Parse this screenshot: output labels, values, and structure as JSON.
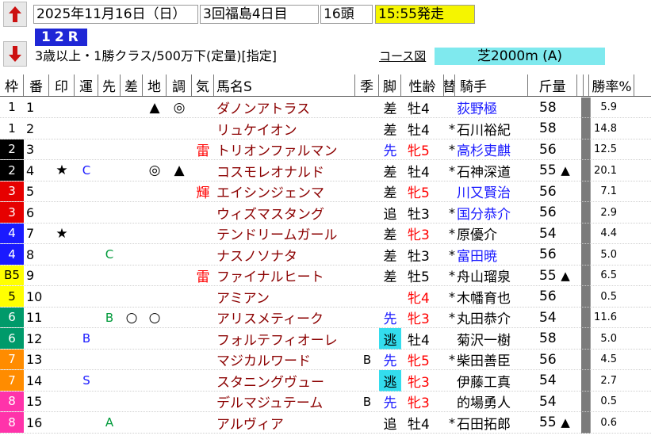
{
  "header": {
    "date": "2025年11月16日（日）",
    "meeting": "3回福島4日目",
    "runners": "16頭",
    "post_time": "15:55発走",
    "race_no": "12R",
    "conditions": "3歳以上・1勝クラス/500万下(定量)[指定]",
    "course_label": "コース図",
    "course": "芝2000m (A)"
  },
  "icons": {
    "up": "up-arrow-icon",
    "down": "down-arrow-icon"
  },
  "colors": {
    "up_arrow": "#cc1111",
    "down_arrow": "#cc1111",
    "race_no_bg": "#1f27d6",
    "post_time_bg": "#f5f500",
    "course_bg": "#7fe9ee"
  },
  "columns": [
    "枠",
    "番",
    "印",
    "運",
    "先",
    "差",
    "地",
    "調",
    "気",
    "馬名S",
    "季",
    "脚",
    "性齢",
    "替",
    "騎手",
    "斤量",
    "勝率%"
  ],
  "rows": [
    {
      "gate": "1",
      "gate_bg": "#ffffff",
      "gate_fg": "#000000",
      "no": "1",
      "mark1": "",
      "mark2": "",
      "sen": "",
      "sa": "",
      "chi": "▲",
      "cho": "◎",
      "ki": "",
      "name": "ダノンアトラス",
      "season": "",
      "style": "差",
      "style_bg": "",
      "sex": "牡4",
      "sex_color": "#000000",
      "change": "",
      "jockey": "荻野極",
      "jockey_color": "#1a1aff",
      "weight": "58",
      "wmark": "",
      "rate": "5.9"
    },
    {
      "gate": "1",
      "gate_bg": "#ffffff",
      "gate_fg": "#000000",
      "no": "2",
      "mark1": "",
      "mark2": "",
      "sen": "",
      "sa": "",
      "chi": "",
      "cho": "",
      "ki": "",
      "name": "リュケイオン",
      "season": "",
      "style": "差",
      "style_bg": "",
      "sex": "牡4",
      "sex_color": "#000000",
      "change": "*",
      "jockey": "石川裕紀",
      "jockey_color": "#000000",
      "weight": "58",
      "wmark": "",
      "rate": "14.8"
    },
    {
      "gate": "2",
      "gate_bg": "#000000",
      "gate_fg": "#ffffff",
      "no": "3",
      "mark1": "",
      "mark2": "",
      "sen": "",
      "sa": "",
      "chi": "",
      "cho": "",
      "ki": "雷",
      "name": "トリオンファルマン",
      "season": "",
      "style": "先",
      "style_bg": "",
      "style_color": "#1a1aff",
      "sex": "牝5",
      "sex_color": "#ff0000",
      "change": "*",
      "jockey": "高杉吏麒",
      "jockey_color": "#1a1aff",
      "weight": "56",
      "wmark": "",
      "rate": "12.5"
    },
    {
      "gate": "2",
      "gate_bg": "#000000",
      "gate_fg": "#ffffff",
      "no": "4",
      "mark1": "★",
      "mark2": "C",
      "sen": "",
      "sa": "",
      "chi": "◎",
      "cho": "▲",
      "ki": "",
      "name": "コスモレオナルド",
      "season": "",
      "style": "差",
      "style_bg": "",
      "sex": "牡4",
      "sex_color": "#000000",
      "change": "*",
      "jockey": "石神深道",
      "jockey_color": "#000000",
      "weight": "55",
      "wmark": "▲",
      "rate": "20.1"
    },
    {
      "gate": "3",
      "gate_bg": "#e60000",
      "gate_fg": "#ffffff",
      "no": "5",
      "mark1": "",
      "mark2": "",
      "sen": "",
      "sa": "",
      "chi": "",
      "cho": "",
      "ki": "輝",
      "name": "エイシンジェンマ",
      "season": "",
      "style": "差",
      "style_bg": "",
      "sex": "牝5",
      "sex_color": "#ff0000",
      "change": "",
      "jockey": "川又賢治",
      "jockey_color": "#1a1aff",
      "weight": "56",
      "wmark": "",
      "rate": "7.1"
    },
    {
      "gate": "3",
      "gate_bg": "#e60000",
      "gate_fg": "#ffffff",
      "no": "6",
      "mark1": "",
      "mark2": "",
      "sen": "",
      "sa": "",
      "chi": "",
      "cho": "",
      "ki": "",
      "name": "ウィズマスタング",
      "season": "",
      "style": "追",
      "style_bg": "",
      "sex": "牡3",
      "sex_color": "#000000",
      "change": "*",
      "jockey": "国分恭介",
      "jockey_color": "#1a1aff",
      "weight": "56",
      "wmark": "",
      "rate": "2.9"
    },
    {
      "gate": "4",
      "gate_bg": "#1a1aff",
      "gate_fg": "#ffffff",
      "no": "7",
      "mark1": "★",
      "mark2": "",
      "sen": "",
      "sa": "",
      "chi": "",
      "cho": "",
      "ki": "",
      "name": "テンドリームガール",
      "season": "",
      "style": "差",
      "style_bg": "",
      "sex": "牝3",
      "sex_color": "#ff0000",
      "change": "*",
      "jockey": "原優介",
      "jockey_color": "#000000",
      "weight": "54",
      "wmark": "",
      "rate": "4.4"
    },
    {
      "gate": "4",
      "gate_bg": "#1a1aff",
      "gate_fg": "#ffffff",
      "no": "8",
      "mark1": "",
      "mark2": "",
      "sen": "C",
      "sa": "",
      "chi": "",
      "cho": "",
      "ki": "",
      "name": "ナスノソナタ",
      "season": "",
      "style": "差",
      "style_bg": "",
      "sex": "牡3",
      "sex_color": "#000000",
      "change": "*",
      "jockey": "富田暁",
      "jockey_color": "#1a1aff",
      "weight": "56",
      "wmark": "",
      "rate": "5.0"
    },
    {
      "gate": "B5",
      "gate_bg": "#ffff00",
      "gate_fg": "#000000",
      "no": "9",
      "mark1": "",
      "mark2": "",
      "sen": "",
      "sa": "",
      "chi": "",
      "cho": "",
      "ki": "雷",
      "name": "ファイナルヒート",
      "season": "",
      "style": "差",
      "style_bg": "",
      "sex": "牡5",
      "sex_color": "#000000",
      "change": "*",
      "jockey": "舟山瑠泉",
      "jockey_color": "#000000",
      "weight": "55",
      "wmark": "▲",
      "rate": "6.5"
    },
    {
      "gate": "5",
      "gate_bg": "#ffff00",
      "gate_fg": "#000000",
      "no": "10",
      "mark1": "",
      "mark2": "",
      "sen": "",
      "sa": "",
      "chi": "",
      "cho": "",
      "ki": "",
      "name": "アミアン",
      "season": "",
      "style": "",
      "style_bg": "",
      "sex": "牝4",
      "sex_color": "#ff0000",
      "change": "*",
      "jockey": "木幡育也",
      "jockey_color": "#000000",
      "weight": "56",
      "wmark": "",
      "rate": "0.5"
    },
    {
      "gate": "6",
      "gate_bg": "#009a6a",
      "gate_fg": "#ffffff",
      "no": "11",
      "mark1": "",
      "mark2": "",
      "sen": "B",
      "sa": "○",
      "chi": "○",
      "cho": "",
      "ki": "",
      "name": "アリスメティーク",
      "season": "",
      "style": "先",
      "style_bg": "",
      "style_color": "#1a1aff",
      "sex": "牝3",
      "sex_color": "#ff0000",
      "change": "*",
      "jockey": "丸田恭介",
      "jockey_color": "#000000",
      "weight": "54",
      "wmark": "",
      "rate": "11.6"
    },
    {
      "gate": "6",
      "gate_bg": "#009a6a",
      "gate_fg": "#ffffff",
      "no": "12",
      "mark1": "",
      "mark2": "B",
      "sen": "",
      "sa": "",
      "chi": "",
      "cho": "",
      "ki": "",
      "name": "フォルテフィオーレ",
      "season": "",
      "style": "逃",
      "style_bg": "#33ddee",
      "sex": "牡4",
      "sex_color": "#000000",
      "change": "",
      "jockey": "菊沢一樹",
      "jockey_color": "#000000",
      "weight": "58",
      "wmark": "",
      "rate": "5.0"
    },
    {
      "gate": "7",
      "gate_bg": "#ff8c00",
      "gate_fg": "#ffffff",
      "no": "13",
      "mark1": "",
      "mark2": "",
      "sen": "",
      "sa": "",
      "chi": "",
      "cho": "",
      "ki": "",
      "name": "マジカルワード",
      "season": "B",
      "style": "先",
      "style_bg": "",
      "style_color": "#1a1aff",
      "sex": "牝5",
      "sex_color": "#ff0000",
      "change": "*",
      "jockey": "柴田善臣",
      "jockey_color": "#000000",
      "weight": "56",
      "wmark": "",
      "rate": "4.5"
    },
    {
      "gate": "7",
      "gate_bg": "#ff8c00",
      "gate_fg": "#ffffff",
      "no": "14",
      "mark1": "",
      "mark2": "S",
      "sen": "",
      "sa": "",
      "chi": "",
      "cho": "",
      "ki": "",
      "name": "スタニングヴュー",
      "season": "",
      "style": "逃",
      "style_bg": "#33ddee",
      "sex": "牝3",
      "sex_color": "#ff0000",
      "change": "",
      "jockey": "伊藤工真",
      "jockey_color": "#000000",
      "weight": "54",
      "wmark": "",
      "rate": "2.7"
    },
    {
      "gate": "8",
      "gate_bg": "#ff33aa",
      "gate_fg": "#ffffff",
      "no": "15",
      "mark1": "",
      "mark2": "",
      "sen": "",
      "sa": "",
      "chi": "",
      "cho": "",
      "ki": "",
      "name": "デルマジュテーム",
      "season": "B",
      "style": "先",
      "style_bg": "",
      "style_color": "#1a1aff",
      "sex": "牝3",
      "sex_color": "#ff0000",
      "change": "",
      "jockey": "的場勇人",
      "jockey_color": "#000000",
      "weight": "54",
      "wmark": "",
      "rate": "0.5"
    },
    {
      "gate": "8",
      "gate_bg": "#ff33aa",
      "gate_fg": "#ffffff",
      "no": "16",
      "mark1": "",
      "mark2": "",
      "sen": "A",
      "sa": "",
      "chi": "",
      "cho": "",
      "ki": "",
      "name": "アルヴィア",
      "season": "",
      "style": "追",
      "style_bg": "",
      "sex": "牡4",
      "sex_color": "#000000",
      "change": "*",
      "jockey": "石田拓郎",
      "jockey_color": "#000000",
      "weight": "55",
      "wmark": "▲",
      "rate": "0.6"
    }
  ]
}
